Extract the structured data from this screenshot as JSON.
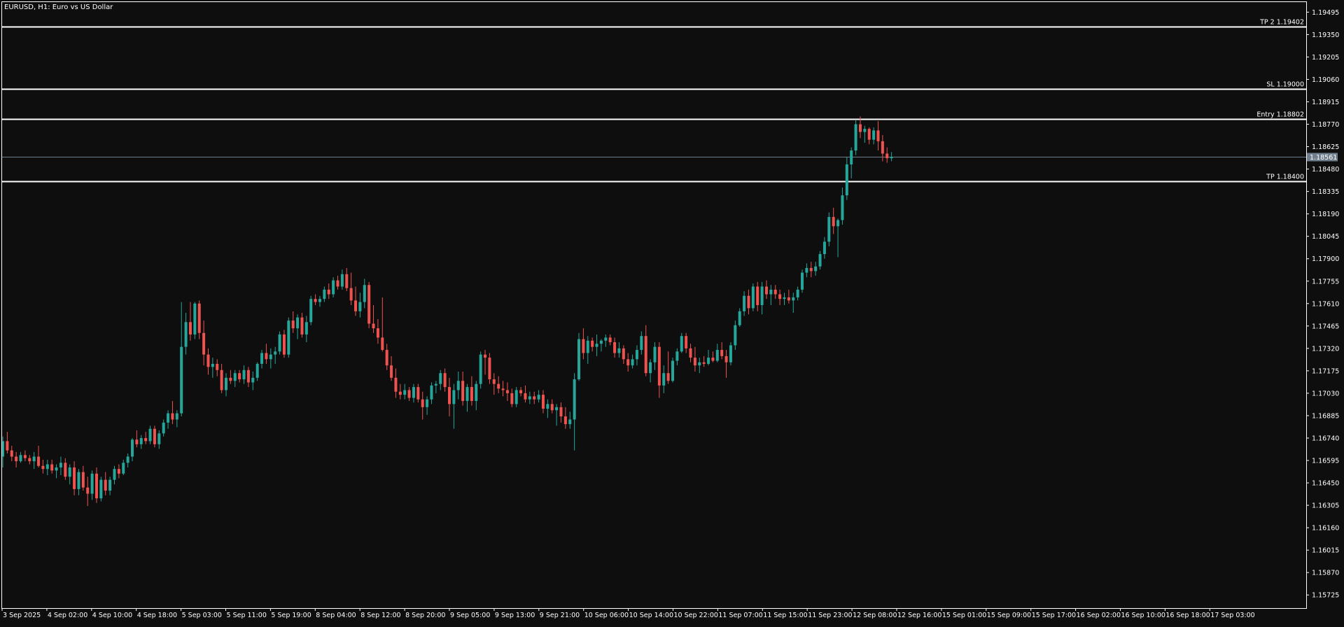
{
  "window": {
    "title": "EURUSD, H1:  Euro vs US Dollar"
  },
  "colors": {
    "background": "#0e0e0e",
    "bull": "#26a69a",
    "bear": "#ef5350",
    "axis": "#ffffff",
    "level_line": "#ffffff",
    "current_price_line": "#6f7e8c",
    "current_price_badge": "#6f7e8c"
  },
  "chart_data": {
    "type": "candlestick",
    "symbol": "EURUSD",
    "timeframe": "H1",
    "title": "EURUSD, H1:  Euro vs US Dollar",
    "grid": false,
    "ylim": [
      1.1564,
      1.1956
    ],
    "y_ticks": [
      "1.19495",
      "1.19350",
      "1.19205",
      "1.19060",
      "1.18915",
      "1.18770",
      "1.18625",
      "1.18480",
      "1.18335",
      "1.18190",
      "1.18045",
      "1.17900",
      "1.17755",
      "1.17610",
      "1.17465",
      "1.17320",
      "1.17175",
      "1.17030",
      "1.16885",
      "1.16740",
      "1.16595",
      "1.16450",
      "1.16305",
      "1.16160",
      "1.16015",
      "1.15870",
      "1.15725"
    ],
    "x_ticks": [
      "3 Sep 2025",
      "4 Sep 02:00",
      "4 Sep 10:00",
      "4 Sep 18:00",
      "5 Sep 03:00",
      "5 Sep 11:00",
      "5 Sep 19:00",
      "8 Sep 04:00",
      "8 Sep 12:00",
      "8 Sep 20:00",
      "9 Sep 05:00",
      "9 Sep 13:00",
      "9 Sep 21:00",
      "10 Sep 06:00",
      "10 Sep 14:00",
      "10 Sep 22:00",
      "11 Sep 07:00",
      "11 Sep 15:00",
      "11 Sep 23:00",
      "12 Sep 08:00",
      "12 Sep 16:00",
      "15 Sep 01:00",
      "15 Sep 09:00",
      "15 Sep 17:00",
      "16 Sep 02:00",
      "16 Sep 10:00",
      "16 Sep 18:00",
      "17 Sep 03:00"
    ],
    "current_price": "1.18561",
    "levels": [
      {
        "label": "TP 2 1.19402",
        "value": 1.19402
      },
      {
        "label": "SL 1.19000",
        "value": 1.19
      },
      {
        "label": "Entry 1.18802",
        "value": 1.18802
      },
      {
        "label": "TP 1.18400",
        "value": 1.184
      }
    ],
    "ohlc_note": "Hourly OHLC values estimated from the price axis.",
    "ohlc": [
      [
        1.1662,
        1.1675,
        1.1655,
        1.1672
      ],
      [
        1.1672,
        1.1678,
        1.1664,
        1.1666
      ],
      [
        1.1666,
        1.1669,
        1.1659,
        1.1662
      ],
      [
        1.1662,
        1.1665,
        1.1655,
        1.1659
      ],
      [
        1.1659,
        1.1665,
        1.1658,
        1.1663
      ],
      [
        1.1663,
        1.1666,
        1.1659,
        1.1661
      ],
      [
        1.1661,
        1.1663,
        1.1657,
        1.1659
      ],
      [
        1.1659,
        1.1665,
        1.1654,
        1.1662
      ],
      [
        1.1662,
        1.1669,
        1.1655,
        1.1656
      ],
      [
        1.1656,
        1.166,
        1.1651,
        1.1654
      ],
      [
        1.1654,
        1.166,
        1.165,
        1.1657
      ],
      [
        1.1657,
        1.166,
        1.1651,
        1.1653
      ],
      [
        1.1653,
        1.1657,
        1.1648,
        1.1655
      ],
      [
        1.1655,
        1.1662,
        1.165,
        1.1658
      ],
      [
        1.1658,
        1.1661,
        1.1647,
        1.1649
      ],
      [
        1.1649,
        1.1657,
        1.1644,
        1.1655
      ],
      [
        1.1655,
        1.1659,
        1.1637,
        1.1641
      ],
      [
        1.1641,
        1.1654,
        1.1637,
        1.1652
      ],
      [
        1.1652,
        1.1656,
        1.164,
        1.1642
      ],
      [
        1.1642,
        1.1649,
        1.163,
        1.1638
      ],
      [
        1.1638,
        1.1653,
        1.1634,
        1.1651
      ],
      [
        1.1651,
        1.1655,
        1.1632,
        1.1635
      ],
      [
        1.1635,
        1.1649,
        1.1633,
        1.1647
      ],
      [
        1.1647,
        1.1652,
        1.1637,
        1.164
      ],
      [
        1.164,
        1.1649,
        1.1637,
        1.1647
      ],
      [
        1.1647,
        1.1656,
        1.1644,
        1.1654
      ],
      [
        1.1654,
        1.1657,
        1.1648,
        1.1651
      ],
      [
        1.1651,
        1.166,
        1.165,
        1.1658
      ],
      [
        1.1658,
        1.1664,
        1.1655,
        1.1662
      ],
      [
        1.1662,
        1.1674,
        1.1659,
        1.1673
      ],
      [
        1.1673,
        1.1679,
        1.1668,
        1.167
      ],
      [
        1.167,
        1.1676,
        1.1667,
        1.1674
      ],
      [
        1.1674,
        1.1678,
        1.167,
        1.1672
      ],
      [
        1.1672,
        1.1682,
        1.167,
        1.168
      ],
      [
        1.168,
        1.1682,
        1.1668,
        1.167
      ],
      [
        1.167,
        1.1679,
        1.1667,
        1.1677
      ],
      [
        1.1677,
        1.1686,
        1.1675,
        1.1684
      ],
      [
        1.1684,
        1.1692,
        1.168,
        1.169
      ],
      [
        1.169,
        1.1698,
        1.1683,
        1.1686
      ],
      [
        1.1686,
        1.1692,
        1.1681,
        1.169
      ],
      [
        1.169,
        1.1762,
        1.1688,
        1.1733
      ],
      [
        1.1733,
        1.1755,
        1.1728,
        1.1749
      ],
      [
        1.1749,
        1.1762,
        1.1737,
        1.1741
      ],
      [
        1.1741,
        1.1762,
        1.1738,
        1.1761
      ],
      [
        1.1761,
        1.1763,
        1.1738,
        1.1742
      ],
      [
        1.1742,
        1.175,
        1.1721,
        1.1728
      ],
      [
        1.1728,
        1.1732,
        1.1715,
        1.172
      ],
      [
        1.172,
        1.1726,
        1.1713,
        1.1722
      ],
      [
        1.1722,
        1.1725,
        1.1714,
        1.1718
      ],
      [
        1.1718,
        1.1722,
        1.1703,
        1.1705
      ],
      [
        1.1705,
        1.1716,
        1.1701,
        1.1713
      ],
      [
        1.1713,
        1.1718,
        1.1709,
        1.1711
      ],
      [
        1.1711,
        1.1718,
        1.1707,
        1.1716
      ],
      [
        1.1716,
        1.1718,
        1.171,
        1.1712
      ],
      [
        1.1712,
        1.1721,
        1.1709,
        1.1718
      ],
      [
        1.1718,
        1.172,
        1.1707,
        1.171
      ],
      [
        1.171,
        1.1717,
        1.1705,
        1.1713
      ],
      [
        1.1713,
        1.1723,
        1.1711,
        1.1722
      ],
      [
        1.1722,
        1.1731,
        1.1719,
        1.1729
      ],
      [
        1.1729,
        1.1735,
        1.1722,
        1.1725
      ],
      [
        1.1725,
        1.1732,
        1.1719,
        1.1728
      ],
      [
        1.1728,
        1.1733,
        1.1722,
        1.173
      ],
      [
        1.173,
        1.1743,
        1.1728,
        1.1741
      ],
      [
        1.1741,
        1.1744,
        1.1726,
        1.1728
      ],
      [
        1.1728,
        1.1752,
        1.1726,
        1.175
      ],
      [
        1.175,
        1.1756,
        1.1742,
        1.1745
      ],
      [
        1.1745,
        1.1754,
        1.1738,
        1.1752
      ],
      [
        1.1752,
        1.1755,
        1.1739,
        1.1741
      ],
      [
        1.1741,
        1.1753,
        1.1736,
        1.1749
      ],
      [
        1.1749,
        1.1766,
        1.1747,
        1.1764
      ],
      [
        1.1764,
        1.1767,
        1.176,
        1.1762
      ],
      [
        1.1762,
        1.1766,
        1.1759,
        1.1764
      ],
      [
        1.1764,
        1.1772,
        1.1762,
        1.177
      ],
      [
        1.177,
        1.1774,
        1.1764,
        1.1767
      ],
      [
        1.1767,
        1.1778,
        1.1765,
        1.1776
      ],
      [
        1.1776,
        1.1779,
        1.177,
        1.1772
      ],
      [
        1.1772,
        1.1783,
        1.177,
        1.178
      ],
      [
        1.178,
        1.1784,
        1.1769,
        1.1771
      ],
      [
        1.1771,
        1.1781,
        1.176,
        1.1763
      ],
      [
        1.1763,
        1.1772,
        1.1753,
        1.1756
      ],
      [
        1.1756,
        1.1768,
        1.1752,
        1.1762
      ],
      [
        1.1762,
        1.1777,
        1.1758,
        1.1773
      ],
      [
        1.1773,
        1.1775,
        1.1745,
        1.1748
      ],
      [
        1.1748,
        1.176,
        1.1742,
        1.1745
      ],
      [
        1.1745,
        1.1751,
        1.1735,
        1.1739
      ],
      [
        1.1739,
        1.1765,
        1.173,
        1.1731
      ],
      [
        1.1731,
        1.1735,
        1.1718,
        1.1721
      ],
      [
        1.1721,
        1.1727,
        1.1711,
        1.1713
      ],
      [
        1.1713,
        1.1719,
        1.17,
        1.1704
      ],
      [
        1.1704,
        1.1709,
        1.1699,
        1.1702
      ],
      [
        1.1702,
        1.1709,
        1.1699,
        1.1705
      ],
      [
        1.1705,
        1.1707,
        1.1698,
        1.17
      ],
      [
        1.17,
        1.1709,
        1.1697,
        1.1707
      ],
      [
        1.1707,
        1.1709,
        1.1697,
        1.1699
      ],
      [
        1.1699,
        1.1704,
        1.1686,
        1.1694
      ],
      [
        1.1694,
        1.1701,
        1.1689,
        1.1699
      ],
      [
        1.1699,
        1.171,
        1.1696,
        1.1708
      ],
      [
        1.1708,
        1.1711,
        1.1703,
        1.1709
      ],
      [
        1.1709,
        1.1718,
        1.1705,
        1.1716
      ],
      [
        1.1716,
        1.1719,
        1.1704,
        1.1707
      ],
      [
        1.1707,
        1.1713,
        1.1688,
        1.1696
      ],
      [
        1.1696,
        1.1709,
        1.168,
        1.1705
      ],
      [
        1.1705,
        1.1717,
        1.1699,
        1.1711
      ],
      [
        1.1711,
        1.1717,
        1.1695,
        1.1698
      ],
      [
        1.1698,
        1.1709,
        1.1691,
        1.1707
      ],
      [
        1.1707,
        1.1714,
        1.1695,
        1.1698
      ],
      [
        1.1698,
        1.1711,
        1.1692,
        1.1709
      ],
      [
        1.1709,
        1.173,
        1.1706,
        1.1728
      ],
      [
        1.1728,
        1.1731,
        1.1715,
        1.1726
      ],
      [
        1.1726,
        1.1729,
        1.1709,
        1.1712
      ],
      [
        1.1712,
        1.1716,
        1.1702,
        1.1709
      ],
      [
        1.1709,
        1.1714,
        1.1703,
        1.1706
      ],
      [
        1.1706,
        1.1711,
        1.1701,
        1.1705
      ],
      [
        1.1705,
        1.171,
        1.1698,
        1.1703
      ],
      [
        1.1703,
        1.1706,
        1.1694,
        1.1696
      ],
      [
        1.1696,
        1.1707,
        1.1694,
        1.1705
      ],
      [
        1.1705,
        1.1707,
        1.1701,
        1.1703
      ],
      [
        1.1703,
        1.1708,
        1.1697,
        1.1699
      ],
      [
        1.1699,
        1.1704,
        1.1696,
        1.1701
      ],
      [
        1.1701,
        1.1704,
        1.1696,
        1.1699
      ],
      [
        1.1699,
        1.1705,
        1.1697,
        1.1702
      ],
      [
        1.1702,
        1.1705,
        1.169,
        1.1693
      ],
      [
        1.1693,
        1.1699,
        1.1687,
        1.1696
      ],
      [
        1.1696,
        1.1699,
        1.169,
        1.1692
      ],
      [
        1.1692,
        1.1696,
        1.1682,
        1.1694
      ],
      [
        1.1694,
        1.1697,
        1.1684,
        1.1688
      ],
      [
        1.1688,
        1.1694,
        1.168,
        1.1683
      ],
      [
        1.1683,
        1.1691,
        1.168,
        1.1686
      ],
      [
        1.1686,
        1.1716,
        1.1666,
        1.1712
      ],
      [
        1.1712,
        1.1742,
        1.1711,
        1.1738
      ],
      [
        1.1738,
        1.1745,
        1.1725,
        1.1729
      ],
      [
        1.1729,
        1.174,
        1.1722,
        1.1737
      ],
      [
        1.1737,
        1.1739,
        1.173,
        1.1733
      ],
      [
        1.1733,
        1.1741,
        1.1727,
        1.1735
      ],
      [
        1.1735,
        1.1738,
        1.173,
        1.1737
      ],
      [
        1.1737,
        1.1741,
        1.1733,
        1.1739
      ],
      [
        1.1739,
        1.1741,
        1.1734,
        1.1736
      ],
      [
        1.1736,
        1.1739,
        1.1726,
        1.1729
      ],
      [
        1.1729,
        1.1736,
        1.1726,
        1.1732
      ],
      [
        1.1732,
        1.1734,
        1.1722,
        1.1725
      ],
      [
        1.1725,
        1.1729,
        1.1717,
        1.1721
      ],
      [
        1.1721,
        1.1728,
        1.1719,
        1.1725
      ],
      [
        1.1725,
        1.1734,
        1.1721,
        1.1731
      ],
      [
        1.1731,
        1.1743,
        1.1728,
        1.174
      ],
      [
        1.174,
        1.1747,
        1.1714,
        1.1716
      ],
      [
        1.1716,
        1.1725,
        1.171,
        1.1723
      ],
      [
        1.1723,
        1.1736,
        1.1718,
        1.1733
      ],
      [
        1.1733,
        1.1736,
        1.17,
        1.1708
      ],
      [
        1.1708,
        1.1721,
        1.1703,
        1.1716
      ],
      [
        1.1716,
        1.173,
        1.1709,
        1.1711
      ],
      [
        1.1711,
        1.1726,
        1.171,
        1.1724
      ],
      [
        1.1724,
        1.1732,
        1.1721,
        1.173
      ],
      [
        1.173,
        1.1742,
        1.1729,
        1.174
      ],
      [
        1.174,
        1.1742,
        1.1729,
        1.1732
      ],
      [
        1.1732,
        1.1735,
        1.1723,
        1.1726
      ],
      [
        1.1726,
        1.1733,
        1.1717,
        1.1721
      ],
      [
        1.1721,
        1.1726,
        1.1716,
        1.1723
      ],
      [
        1.1723,
        1.1727,
        1.172,
        1.1722
      ],
      [
        1.1722,
        1.1731,
        1.1721,
        1.1726
      ],
      [
        1.1726,
        1.173,
        1.1723,
        1.1724
      ],
      [
        1.1724,
        1.1735,
        1.1723,
        1.1731
      ],
      [
        1.1731,
        1.1736,
        1.1725,
        1.1727
      ],
      [
        1.1727,
        1.1731,
        1.1713,
        1.1723
      ],
      [
        1.1723,
        1.1736,
        1.1721,
        1.1734
      ],
      [
        1.1734,
        1.175,
        1.1731,
        1.1747
      ],
      [
        1.1747,
        1.1758,
        1.1746,
        1.1756
      ],
      [
        1.1756,
        1.1769,
        1.1753,
        1.1766
      ],
      [
        1.1766,
        1.177,
        1.1754,
        1.1758
      ],
      [
        1.1758,
        1.1774,
        1.1756,
        1.1772
      ],
      [
        1.1772,
        1.1775,
        1.1756,
        1.176
      ],
      [
        1.176,
        1.1775,
        1.1754,
        1.1772
      ],
      [
        1.1772,
        1.1776,
        1.1764,
        1.1767
      ],
      [
        1.1767,
        1.1773,
        1.176,
        1.177
      ],
      [
        1.177,
        1.1773,
        1.1764,
        1.1767
      ],
      [
        1.1767,
        1.177,
        1.176,
        1.1764
      ],
      [
        1.1764,
        1.1768,
        1.176,
        1.1765
      ],
      [
        1.1765,
        1.177,
        1.1761,
        1.1763
      ],
      [
        1.1763,
        1.1768,
        1.1755,
        1.1765
      ],
      [
        1.1765,
        1.1772,
        1.1763,
        1.177
      ],
      [
        1.177,
        1.1783,
        1.1768,
        1.1781
      ],
      [
        1.1781,
        1.1787,
        1.1778,
        1.1784
      ],
      [
        1.1784,
        1.1788,
        1.1778,
        1.1782
      ],
      [
        1.1782,
        1.1788,
        1.1779,
        1.1785
      ],
      [
        1.1785,
        1.1795,
        1.1783,
        1.1793
      ],
      [
        1.1793,
        1.1804,
        1.179,
        1.1801
      ],
      [
        1.1801,
        1.182,
        1.1798,
        1.1817
      ],
      [
        1.1817,
        1.1823,
        1.1806,
        1.1811
      ],
      [
        1.1811,
        1.1816,
        1.1791,
        1.1815
      ],
      [
        1.1815,
        1.1836,
        1.1812,
        1.1831
      ],
      [
        1.1831,
        1.1856,
        1.1828,
        1.1851
      ],
      [
        1.1851,
        1.1862,
        1.1842,
        1.186
      ],
      [
        1.186,
        1.188,
        1.1857,
        1.1877
      ],
      [
        1.1877,
        1.1882,
        1.1868,
        1.1872
      ],
      [
        1.1872,
        1.1876,
        1.1865,
        1.1874
      ],
      [
        1.1874,
        1.1875,
        1.1864,
        1.1867
      ],
      [
        1.1867,
        1.1875,
        1.1864,
        1.1873
      ],
      [
        1.1873,
        1.1879,
        1.186,
        1.1866
      ],
      [
        1.1866,
        1.187,
        1.1853,
        1.1858
      ],
      [
        1.1858,
        1.1862,
        1.1852,
        1.1855
      ],
      [
        1.1855,
        1.1859,
        1.1853,
        1.1856
      ]
    ]
  }
}
